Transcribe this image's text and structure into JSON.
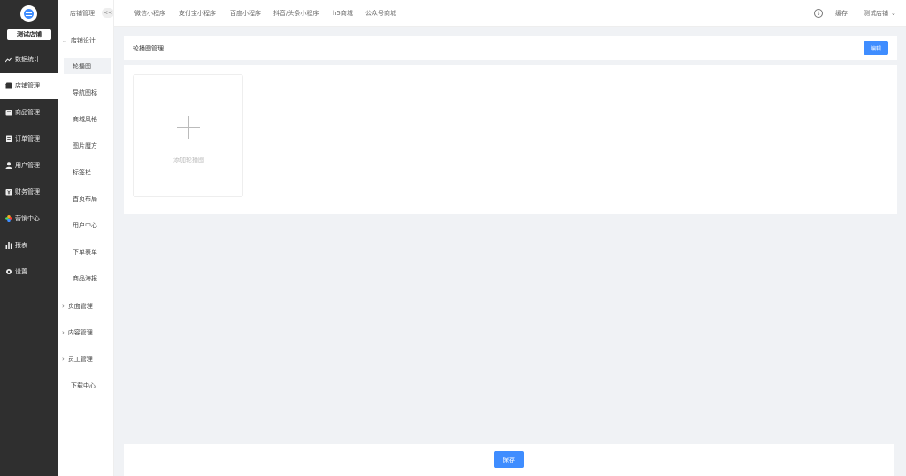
{
  "sidebar": {
    "store_name": "测试店铺",
    "items": [
      {
        "label": "数据统计",
        "icon": "line-chart-icon"
      },
      {
        "label": "店铺管理",
        "icon": "shop-icon"
      },
      {
        "label": "商品管理",
        "icon": "goods-icon"
      },
      {
        "label": "订单管理",
        "icon": "order-icon"
      },
      {
        "label": "用户管理",
        "icon": "user-icon"
      },
      {
        "label": "财务管理",
        "icon": "finance-icon"
      },
      {
        "label": "营销中心",
        "icon": "marketing-icon"
      },
      {
        "label": "报表",
        "icon": "bar-chart-icon"
      },
      {
        "label": "设置",
        "icon": "gear-icon"
      }
    ]
  },
  "subnav": {
    "title": "店铺管理",
    "collapse_label": "<<",
    "group_design": "店铺设计",
    "items": [
      "轮播图",
      "导航图标",
      "商城风格",
      "图片魔方",
      "标签栏",
      "首页布局",
      "用户中心",
      "下单表单",
      "商品海报"
    ],
    "groups": [
      "页面管理",
      "内容管理",
      "员工管理"
    ],
    "download_center": "下载中心"
  },
  "topbar": {
    "tabs": [
      "微信小程序",
      "支付宝小程序",
      "百度小程序",
      "抖音/头条小程序",
      "h5商城",
      "公众号商城"
    ],
    "cache_label": "缓存",
    "store_select": "测试店铺"
  },
  "panel": {
    "title": "轮播图管理",
    "edit_label": "编辑",
    "add_label": "添加轮播图"
  },
  "footer": {
    "save_label": "保存"
  },
  "colors": {
    "accent": "#3f8dff",
    "sidebar_bg": "#2f2f2f",
    "page_bg": "#f0f2f5"
  }
}
